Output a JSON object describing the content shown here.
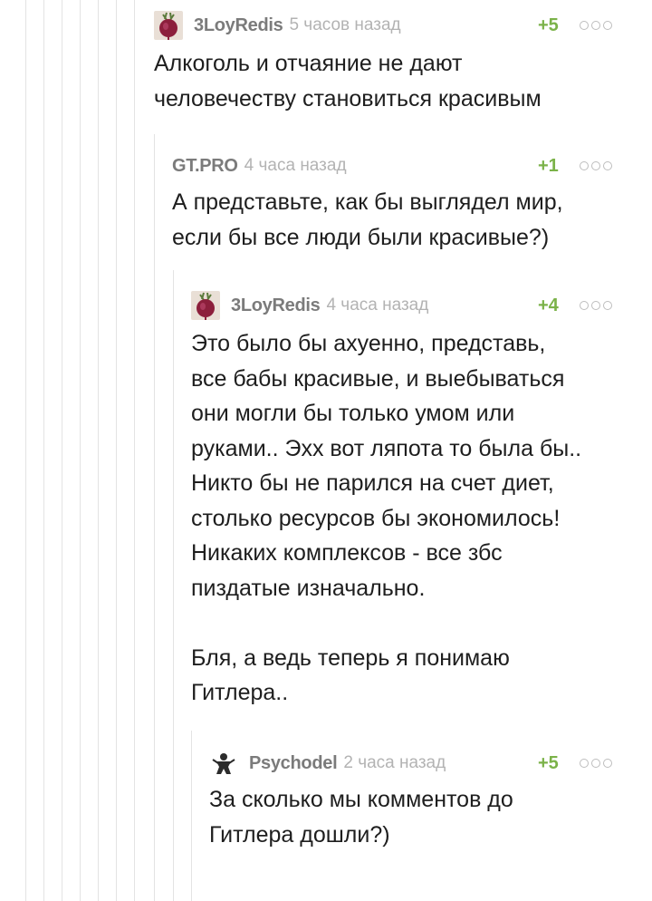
{
  "comments": [
    {
      "author": "3LoyRedis",
      "time": "5 часов назад",
      "rating": "+5",
      "avatar_icon": "beet-avatar-icon",
      "text": "Алкоголь и отчаяние не дают\nчеловечеству становиться красивым"
    },
    {
      "author": "GT.PRO",
      "time": "4 часа назад",
      "rating": "+1",
      "avatar_icon": "",
      "text": "А представьте, как бы выглядел мир,\nесли бы все люди были красивые?)"
    },
    {
      "author": "3LoyRedis",
      "time": "4 часа назад",
      "rating": "+4",
      "avatar_icon": "beet-avatar-icon",
      "text": "Это было бы ахуенно, представь,\nвсе бабы красивые, и выебываться\nони могли бы только умом или\nруками.. Эхх вот ляпота то была бы..\nНикто бы не парился на счет диет,\nстолько ресурсов бы экономилось!\nНикаких комплексов - все збс\nпиздатые изначально.\n\nБля, а ведь теперь я понимаю\nГитлера.."
    },
    {
      "author": "Psychodel",
      "time": "2 часа назад",
      "rating": "+5",
      "avatar_icon": "figure-avatar-icon",
      "text": "За сколько мы комментов до\nГитлера дошли?)"
    }
  ],
  "colors": {
    "rating": "#7bb249",
    "author": "#7b7b7b",
    "time": "#b3b3b3",
    "thread_line": "#e3e3e3"
  }
}
